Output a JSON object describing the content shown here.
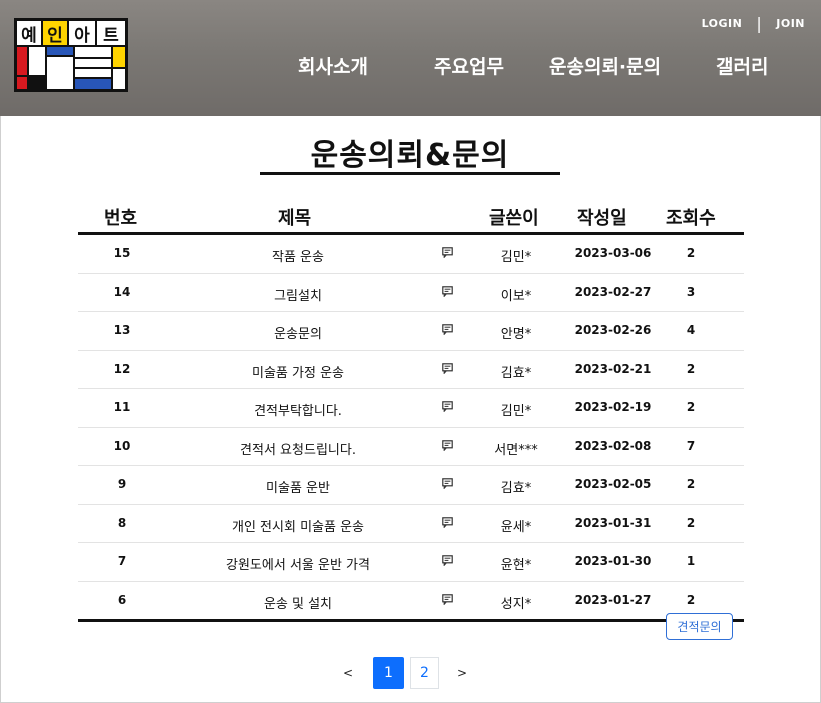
{
  "header": {
    "logo": {
      "chars": [
        "예",
        "인",
        "아",
        "트"
      ],
      "colors": {
        "red": "#d71920",
        "yellow": "#ffd400",
        "blue": "#2856b8",
        "black": "#111111"
      }
    },
    "auth": {
      "login": "LOGIN",
      "separator": "|",
      "join": "JOIN"
    },
    "nav": [
      "회사소개",
      "주요업무",
      "운송의뢰·문의",
      "갤러리"
    ]
  },
  "page": {
    "title": "운송의뢰&문의"
  },
  "table": {
    "columns": [
      "번호",
      "제목",
      "글쓴이",
      "작성일",
      "조회수"
    ],
    "rows": [
      {
        "num": "15",
        "title": "작품 운송",
        "icon": "comment-icon",
        "writer": "김민*",
        "date": "2023-03-06",
        "views": "2"
      },
      {
        "num": "14",
        "title": "그림설치",
        "icon": "comment-icon",
        "writer": "이보*",
        "date": "2023-02-27",
        "views": "3"
      },
      {
        "num": "13",
        "title": "운송문의",
        "icon": "comment-icon",
        "writer": "안명*",
        "date": "2023-02-26",
        "views": "4"
      },
      {
        "num": "12",
        "title": "미술품 가정 운송",
        "icon": "comment-icon",
        "writer": "김효*",
        "date": "2023-02-21",
        "views": "2"
      },
      {
        "num": "11",
        "title": "견적부탁합니다.",
        "icon": "comment-icon",
        "writer": "김민*",
        "date": "2023-02-19",
        "views": "2"
      },
      {
        "num": "10",
        "title": "견적서 요청드립니다.",
        "icon": "comment-icon",
        "writer": "서면***",
        "date": "2023-02-08",
        "views": "7"
      },
      {
        "num": "9",
        "title": "미술품 운반",
        "icon": "comment-icon",
        "writer": "김효*",
        "date": "2023-02-05",
        "views": "2"
      },
      {
        "num": "8",
        "title": "개인 전시회 미술품 운송",
        "icon": "comment-icon",
        "writer": "윤세*",
        "date": "2023-01-31",
        "views": "2"
      },
      {
        "num": "7",
        "title": "강원도에서 서울 운반 가격",
        "icon": "comment-icon",
        "writer": "윤현*",
        "date": "2023-01-30",
        "views": "1"
      },
      {
        "num": "6",
        "title": "운송 및 설치",
        "icon": "comment-icon",
        "writer": "성지*",
        "date": "2023-01-27",
        "views": "2"
      }
    ]
  },
  "actions": {
    "quote_button": "견적문의"
  },
  "pagination": {
    "prev": "<",
    "pages": [
      "1",
      "2"
    ],
    "current": "1",
    "next": ">",
    "accent": "#0d6efd"
  }
}
